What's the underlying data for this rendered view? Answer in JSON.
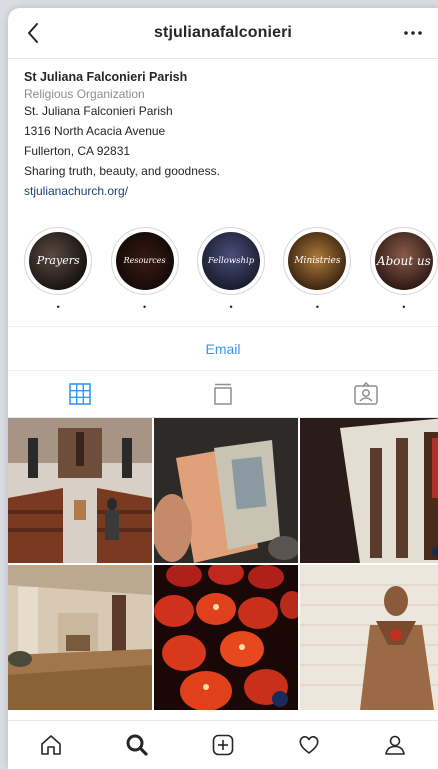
{
  "header": {
    "username": "stjulianafalconieri"
  },
  "profile": {
    "name": "St Juliana Falconieri Parish",
    "category": "Religious Organization",
    "address_line1": "St. Juliana Falconieri Parish",
    "address_line2": "1316 North Acacia Avenue",
    "address_line3": "Fullerton, CA 92831",
    "tagline": "Sharing truth, beauty, and goodness.",
    "website": "stjulianachurch.org/"
  },
  "highlights": [
    {
      "title": "Prayers",
      "label": "•"
    },
    {
      "title": "Resources",
      "label": "•"
    },
    {
      "title": "Fellowship",
      "label": "•"
    },
    {
      "title": "Ministries",
      "label": "•"
    },
    {
      "title": "About us",
      "label": "•"
    }
  ],
  "contact": {
    "email_label": "Email"
  },
  "tabs": [
    "grid",
    "feed",
    "tagged"
  ],
  "colors": {
    "link_blue": "#3897f0",
    "active_tab": "#3897f0",
    "inactive_icon": "#8e8e8e"
  },
  "bottom_nav": [
    "home",
    "search",
    "new-post",
    "activity",
    "profile"
  ]
}
